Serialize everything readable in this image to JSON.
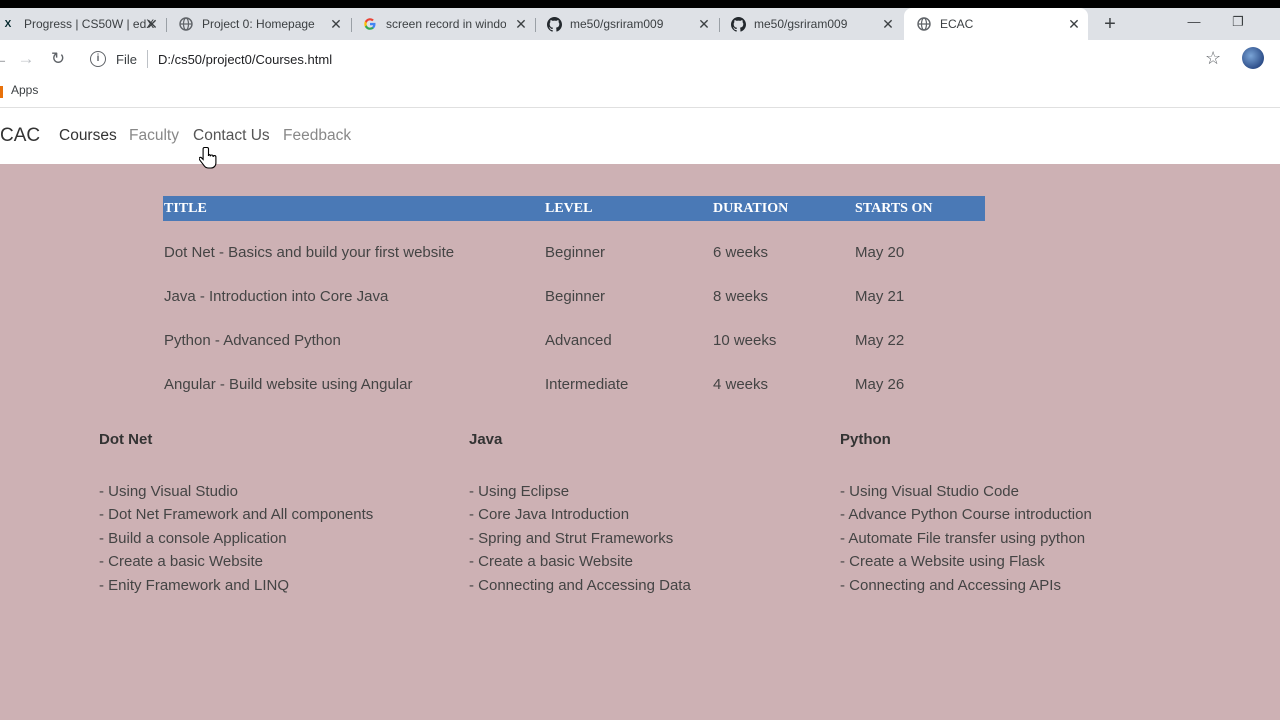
{
  "browser": {
    "tabs": [
      {
        "title": "Progress | CS50W | edX",
        "favicon": "edx-icon"
      },
      {
        "title": "Project 0: Homepage",
        "favicon": "globe-icon"
      },
      {
        "title": "screen record in windo",
        "favicon": "google-icon"
      },
      {
        "title": "me50/gsriram009",
        "favicon": "github-icon"
      },
      {
        "title": "me50/gsriram009",
        "favicon": "github-icon"
      },
      {
        "title": "ECAC",
        "favicon": "globe-icon",
        "active": true
      }
    ],
    "address": {
      "scheme_label": "File",
      "url": "D:/cs50/project0/Courses.html"
    },
    "bookmarks": {
      "apps_label": "Apps"
    }
  },
  "site": {
    "brand": "CAC",
    "nav": [
      "Courses",
      "Faculty",
      "Contact Us",
      "Feedback"
    ],
    "table": {
      "headers": [
        "TITLE",
        "LEVEL",
        "DURATION",
        "STARTS ON"
      ],
      "rows": [
        [
          "Dot Net - Basics and build your first website",
          "Beginner",
          "6 weeks",
          "May 20"
        ],
        [
          "Java - Introduction into Core Java",
          "Beginner",
          "8 weeks",
          "May 21"
        ],
        [
          "Python - Advanced Python",
          "Advanced",
          "10 weeks",
          "May 22"
        ],
        [
          "Angular - Build website using Angular",
          "Intermediate",
          "4 weeks",
          "May 26"
        ]
      ]
    },
    "columns": [
      {
        "title": "Dot Net",
        "items": [
          "- Using Visual Studio",
          "- Dot Net Framework and All components",
          "- Build a console Application",
          "- Create a basic Website",
          "- Enity Framework and LINQ"
        ]
      },
      {
        "title": "Java",
        "items": [
          "- Using Eclipse",
          "- Core Java Introduction",
          "- Spring and Strut Frameworks",
          "- Create a basic Website",
          "- Connecting and Accessing Data"
        ]
      },
      {
        "title": "Python",
        "items": [
          "- Using Visual Studio Code",
          "- Advance Python Course introduction",
          "- Automate File transfer using python",
          "- Create a Website using Flask",
          "- Connecting and Accessing APIs"
        ]
      }
    ]
  },
  "colors": {
    "page_background": "#cdb1b4",
    "table_header": "#4a79b6"
  }
}
